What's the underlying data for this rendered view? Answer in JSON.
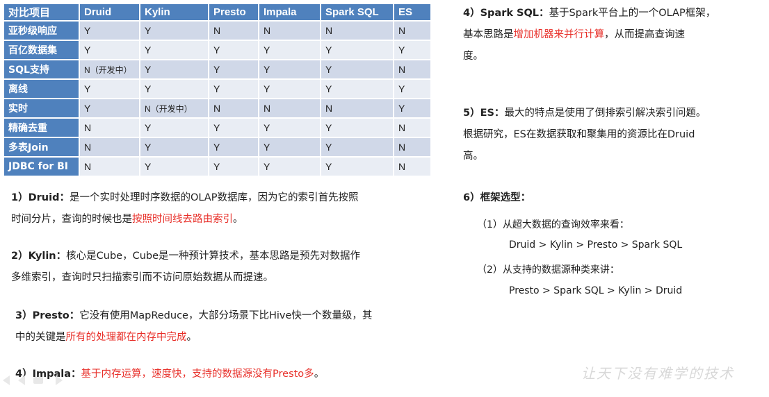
{
  "table": {
    "headers": [
      "对比项目",
      "Druid",
      "Kylin",
      "Presto",
      "Impala",
      "Spark SQL",
      "ES"
    ],
    "rows": [
      {
        "label": "亚秒级响应",
        "cells": [
          "Y",
          "Y",
          "N",
          "N",
          "N",
          "N"
        ]
      },
      {
        "label": "百亿数据集",
        "cells": [
          "Y",
          "Y",
          "Y",
          "Y",
          "Y",
          "Y"
        ]
      },
      {
        "label": "SQL支持",
        "cells": [
          "N（开发中）",
          "Y",
          "Y",
          "Y",
          "Y",
          "N"
        ]
      },
      {
        "label": "离线",
        "cells": [
          "Y",
          "Y",
          "Y",
          "Y",
          "Y",
          "Y"
        ]
      },
      {
        "label": "实时",
        "cells": [
          "Y",
          "N（开发中）",
          "N",
          "N",
          "N",
          "Y"
        ]
      },
      {
        "label": "精确去重",
        "cells": [
          "N",
          "Y",
          "Y",
          "Y",
          "Y",
          "N"
        ]
      },
      {
        "label": "多表Join",
        "cells": [
          "N",
          "Y",
          "Y",
          "Y",
          "Y",
          "N"
        ]
      },
      {
        "label": "JDBC for BI",
        "cells": [
          "N",
          "Y",
          "Y",
          "Y",
          "Y",
          "N"
        ]
      }
    ]
  },
  "p_druid": {
    "head": "1）Druid：",
    "t1": "是一个实时处理时序数据的OLAP数据库，因为它的索引首先按照",
    "t2": "时间分片，查询的时候也是",
    "red": "按照时间线去路由索引",
    "t3": "。"
  },
  "p_kylin": {
    "head": "2）Kylin：",
    "t1": "核心是Cube，Cube是一种预计算技术，基本思路是预先对数据作",
    "t2": "多维索引，查询时只扫描索引而不访问原始数据从而提速。"
  },
  "p_presto": {
    "head": "3）Presto：",
    "t1": "它没有使用MapReduce，大部分场景下比Hive快一个数量级，其",
    "t2": "中的关键是",
    "red": "所有的处理都在内存中完成",
    "t3": "。"
  },
  "p_impala": {
    "head": "4）Impala：",
    "red": "基于内存运算，速度快，支持的数据源没有Presto多",
    "t1": "。"
  },
  "p_spark": {
    "head": "4）Spark SQL：",
    "t1": "基于Spark平台上的一个OLAP框架，",
    "t2": "基本思路是",
    "red": "增加机器来并行计算",
    "t3": "，从而提高查询速",
    "t4": "度。"
  },
  "p_es": {
    "head": "5）ES：",
    "t1": "最大的特点是使用了倒排索引解决索引问题。",
    "t2": "根据研究，ES在数据获取和聚集用的资源比在Druid",
    "t3": "高。"
  },
  "p_select": {
    "head": "6）框架选型：",
    "q1": "（1）从超大数据的查询效率来看：",
    "a1": "Druid > Kylin > Presto > Spark SQL",
    "q2": "（2）从支持的数据源种类来讲：",
    "a2": "Presto > Spark SQL > Kylin > Druid"
  },
  "watermark": "让天下没有难学的技术",
  "colors": {
    "header": "#4f81bd",
    "row_odd": "#d0d8e8",
    "row_even": "#e9edf4",
    "highlight": "#e8302a"
  }
}
